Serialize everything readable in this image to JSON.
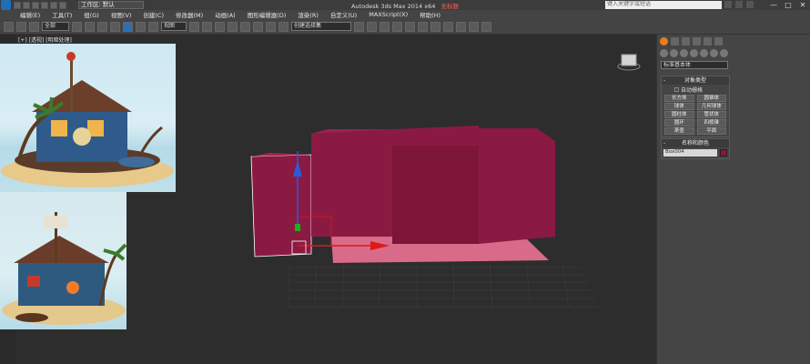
{
  "titlebar": {
    "workspace": "工作区: 默认",
    "title": "Autodesk 3ds Max 2014 x64",
    "document": "无标题",
    "search_placeholder": "键入关键字或短语",
    "minimize": "—",
    "maximize": "□",
    "close": "✕"
  },
  "menu": [
    "编辑(E)",
    "工具(T)",
    "组(G)",
    "视图(V)",
    "创建(C)",
    "修改器(M)",
    "动画(A)",
    "图形编辑器(D)",
    "渲染(R)",
    "自定义(U)",
    "MAXScript(X)",
    "帮助(H)"
  ],
  "toolbar": {
    "selection_filter": "全部",
    "reference_coord": "视图",
    "named_selection": "创建选择集"
  },
  "viewport": {
    "label": "[+] [透视] [明暗处理]"
  },
  "command_panel": {
    "category": "标准基本体",
    "object_type": {
      "title": "对象类型",
      "autogrid": "自动栅格",
      "primitives": [
        "长方体",
        "圆锥体",
        "球体",
        "几何球体",
        "圆柱体",
        "管状体",
        "圆环",
        "四棱锥",
        "茶壶",
        "平面"
      ]
    },
    "name_color": {
      "title": "名称和颜色",
      "name_value": "Box004",
      "color": "#8a1538"
    }
  },
  "colors": {
    "box": "#8b1a43",
    "box_selected_ground": "#d96b8a",
    "accent_blue": "#2f6fb5"
  }
}
